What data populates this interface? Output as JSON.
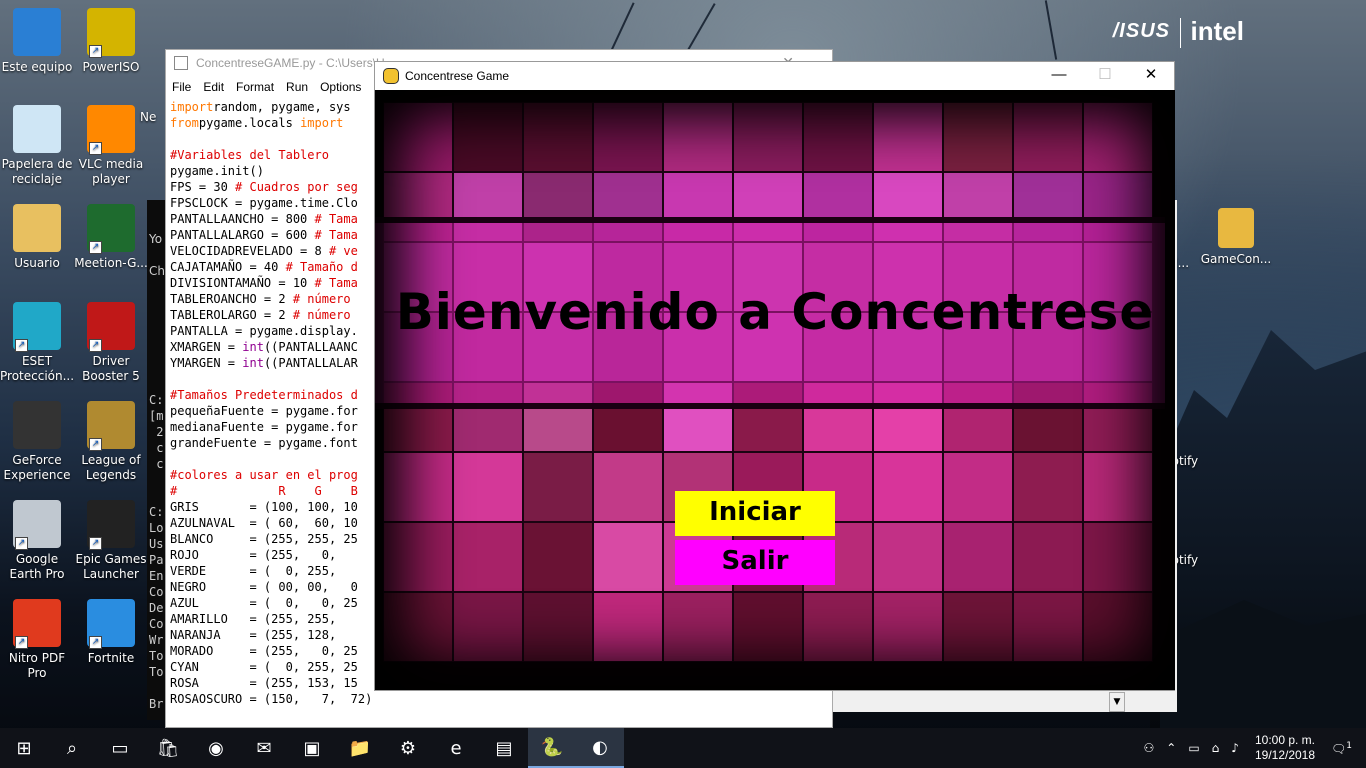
{
  "brand": {
    "asus": "/ISUS",
    "intel": "intel"
  },
  "desktop_icons": [
    {
      "label": "Este equipo",
      "color": "#2a7fd4",
      "shortcut": false
    },
    {
      "label": "PowerISO",
      "color": "#d4b400",
      "shortcut": true
    },
    {
      "label": "Papelera de reciclaje",
      "color": "#cfe6f5",
      "shortcut": false
    },
    {
      "label": "VLC media player",
      "color": "#ff8800",
      "shortcut": true
    },
    {
      "label": "Usuario",
      "color": "#e8c060",
      "shortcut": false
    },
    {
      "label": "Meetion-G...",
      "color": "#1e6b2e",
      "shortcut": true
    },
    {
      "label": "ESET Protección...",
      "color": "#20a8c8",
      "shortcut": true
    },
    {
      "label": "Driver Booster 5",
      "color": "#c01818",
      "shortcut": true
    },
    {
      "label": "GeForce Experience",
      "color": "#333333",
      "shortcut": false
    },
    {
      "label": "League of Legends",
      "color": "#b08a30",
      "shortcut": true
    },
    {
      "label": "Google Earth Pro",
      "color": "#c0c8d0",
      "shortcut": true
    },
    {
      "label": "Epic Games Launcher",
      "color": "#222222",
      "shortcut": true
    },
    {
      "label": "Nitro PDF Pro",
      "color": "#e03a1e",
      "shortcut": true
    },
    {
      "label": "Fortnite",
      "color": "#2a8de0",
      "shortcut": true
    }
  ],
  "partial_labels": {
    "ne": "Ne",
    "yo": "Yo",
    "ch": "Ch"
  },
  "right_icons": {
    "gamecon": "GameCon...",
    "fl": "oFl...",
    "spotify1": "potify",
    "spotify2": "potify"
  },
  "idle": {
    "title": "ConcentreseGAME.py - C:\\Users\\U...",
    "menu": [
      "File",
      "Edit",
      "Format",
      "Run",
      "Options"
    ],
    "code_lines": [
      [
        [
          "kw",
          "import"
        ],
        [
          "",
          "random, pygame, sys"
        ]
      ],
      [
        [
          "kw",
          "from"
        ],
        [
          "",
          "pygame.locals "
        ],
        [
          "kw",
          "import"
        ]
      ],
      [
        [
          "",
          ""
        ]
      ],
      [
        [
          "cm",
          "#Variables del Tablero"
        ]
      ],
      [
        [
          "",
          "pygame.init()"
        ]
      ],
      [
        [
          "",
          "FPS = 30 "
        ],
        [
          "cm",
          "# Cuadros por seg"
        ]
      ],
      [
        [
          "",
          "FPSCLOCK = pygame.time.Clo"
        ]
      ],
      [
        [
          "",
          "PANTALLAANCHO = 800 "
        ],
        [
          "cm",
          "# Tama"
        ]
      ],
      [
        [
          "",
          "PANTALLALARGO = 600 "
        ],
        [
          "cm",
          "# Tama"
        ]
      ],
      [
        [
          "",
          "VELOCIDADREVELADO = 8 "
        ],
        [
          "cm",
          "# ve"
        ]
      ],
      [
        [
          "",
          "CAJATAMAÑO = 40 "
        ],
        [
          "cm",
          "# Tamaño d"
        ]
      ],
      [
        [
          "",
          "DIVISIONTAMAÑO = 10 "
        ],
        [
          "cm",
          "# Tama"
        ]
      ],
      [
        [
          "",
          "TABLEROANCHO = 2 "
        ],
        [
          "cm",
          "# número"
        ]
      ],
      [
        [
          "",
          "TABLEROLARGO = 2 "
        ],
        [
          "cm",
          "# número"
        ]
      ],
      [
        [
          "",
          "PANTALLA = pygame.display."
        ]
      ],
      [
        [
          "",
          "XMARGEN = "
        ],
        [
          "bi",
          "int"
        ],
        [
          "",
          "((PANTALLAANC"
        ]
      ],
      [
        [
          "",
          "YMARGEN = "
        ],
        [
          "bi",
          "int"
        ],
        [
          "",
          "((PANTALLALAR"
        ]
      ],
      [
        [
          "",
          ""
        ]
      ],
      [
        [
          "cm",
          "#Tamaños Predeterminados d"
        ]
      ],
      [
        [
          "",
          "pequeñaFuente = pygame.for"
        ]
      ],
      [
        [
          "",
          "medianaFuente = pygame.for"
        ]
      ],
      [
        [
          "",
          "grandeFuente = pygame.font"
        ]
      ],
      [
        [
          "",
          ""
        ]
      ],
      [
        [
          "cm",
          "#colores a usar en el prog"
        ]
      ],
      [
        [
          "cm",
          "#              R    G    B"
        ]
      ],
      [
        [
          "",
          "GRIS       = (100, 100, 10"
        ]
      ],
      [
        [
          "",
          "AZULNAVAL  = ( 60,  60, 10"
        ]
      ],
      [
        [
          "",
          "BLANCO     = (255, 255, 25"
        ]
      ],
      [
        [
          "",
          "ROJO       = (255,   0,"
        ]
      ],
      [
        [
          "",
          "VERDE      = (  0, 255,"
        ]
      ],
      [
        [
          "",
          "NEGRO      = ( 00, 00,   0"
        ]
      ],
      [
        [
          "",
          "AZUL       = (  0,   0, 25"
        ]
      ],
      [
        [
          "",
          "AMARILLO   = (255, 255,"
        ]
      ],
      [
        [
          "",
          "NARANJA    = (255, 128,"
        ]
      ],
      [
        [
          "",
          "MORADO     = (255,   0, 25"
        ]
      ],
      [
        [
          "",
          "CYAN       = (  0, 255, 25"
        ]
      ],
      [
        [
          "",
          "ROSA       = (255, 153, 15"
        ]
      ],
      [
        [
          "",
          "ROSAOSCURO = (150,   7,  72)"
        ]
      ]
    ]
  },
  "console_text": "\n\n\n\n\n\n\n\n\n\n\n\nC:\n[m\n 2\n c\n c\n\n\nC:\nLo\nUs\nPa\nEn\nCo\nDe\nCo\nWr\nTo\nTo\n\nBr\n\nC:",
  "game": {
    "title": "Concentrese Game",
    "heading": "Bienvenido a Concentrese",
    "start_label": "Iniciar",
    "quit_label": "Salir",
    "tile_colors": [
      "#9a1a6a",
      "#4a0a26",
      "#5a0e30",
      "#7a1450",
      "#b02a80",
      "#8a1c5e",
      "#6e1244",
      "#c03090",
      "#7a2040",
      "#8e1c5a",
      "#a02070",
      "#b02880",
      "#c040a8",
      "#8a2a70",
      "#a03090",
      "#c838b0",
      "#d040b8",
      "#b030a0",
      "#d848c0",
      "#c040a8",
      "#a03098",
      "#9a2488",
      "#b63a9e",
      "#c844b0",
      "#d04cc0",
      "#b238a0",
      "#c640b4",
      "#d050c0",
      "#c040a8",
      "#d24abc",
      "#c442ae",
      "#b43aa2",
      "#a83298",
      "#a02a88",
      "#b8389e",
      "#c244b0",
      "#a63290",
      "#cc46b8",
      "#d64cc4",
      "#c03ca8",
      "#c846b6",
      "#b63aa0",
      "#aa3496",
      "#9c2c88",
      "#8a1a4a",
      "#a02a70",
      "#b84a8a",
      "#6a1030",
      "#e050c0",
      "#8a1a4a",
      "#d8389a",
      "#e440a8",
      "#b02470",
      "#6a1232",
      "#901c56",
      "#c42a86",
      "#d43898",
      "#7a1c46",
      "#c23a88",
      "#b23276",
      "#9a1a5a",
      "#c82a88",
      "#d8349a",
      "#c22c86",
      "#8e1c50",
      "#b82878",
      "#9a1c5e",
      "#a82268",
      "#6a1234",
      "#d84aa4",
      "#cc3a94",
      "#70163a",
      "#b82a78",
      "#c23086",
      "#a82270",
      "#8c1a52",
      "#7e1648",
      "#6a1236",
      "#7a1646",
      "#5e1030",
      "#c0287c",
      "#9c2060",
      "#600e2e",
      "#8e1c52",
      "#a42266",
      "#6e1438",
      "#7c1644",
      "#5a0e2c"
    ]
  },
  "taskbar": {
    "items": [
      {
        "name": "windows-start-icon",
        "glyph": "⊞"
      },
      {
        "name": "search-icon",
        "glyph": "⌕"
      },
      {
        "name": "task-view-icon",
        "glyph": "▭"
      },
      {
        "name": "store-icon",
        "glyph": "🛍"
      },
      {
        "name": "chrome-icon",
        "glyph": "◉"
      },
      {
        "name": "mail-icon",
        "glyph": "✉"
      },
      {
        "name": "control-panel-icon",
        "glyph": "▣"
      },
      {
        "name": "file-explorer-icon",
        "glyph": "📁"
      },
      {
        "name": "driver-booster-icon",
        "glyph": "⚙"
      },
      {
        "name": "edge-icon",
        "glyph": "e"
      },
      {
        "name": "terminal-icon",
        "glyph": "▤"
      },
      {
        "name": "python-icon",
        "glyph": "🐍"
      },
      {
        "name": "pygame-window-icon",
        "glyph": "◐"
      }
    ],
    "time": "10:00 p. m.",
    "date": "19/12/2018",
    "notifications": "1"
  }
}
